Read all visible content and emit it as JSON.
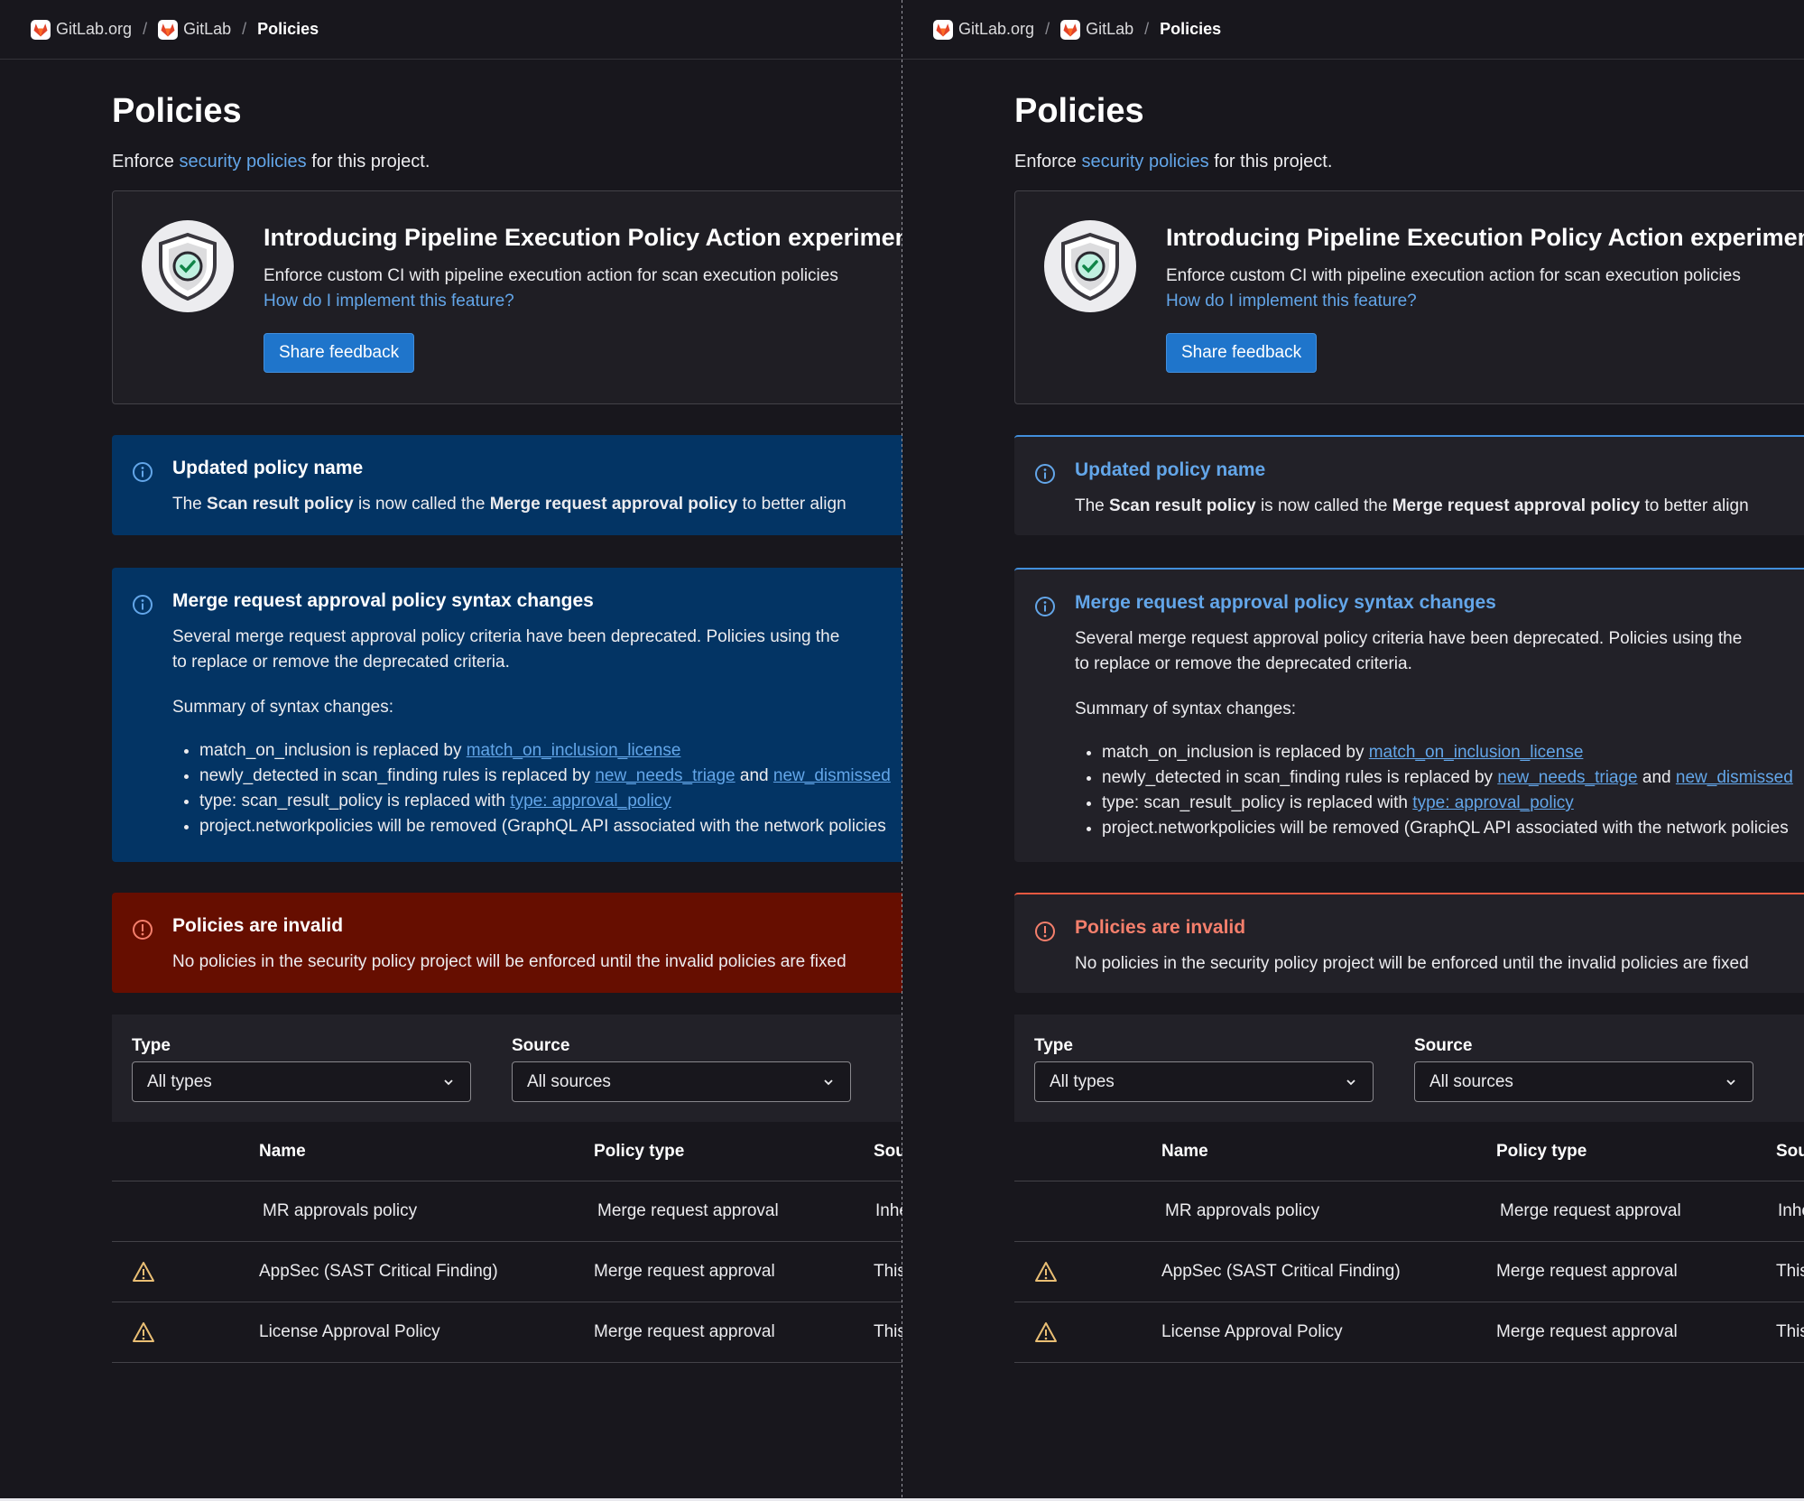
{
  "breadcrumb": {
    "items": [
      "GitLab.org",
      "GitLab"
    ],
    "separator": "/",
    "current": "Policies"
  },
  "page": {
    "title": "Policies",
    "subtitle_prefix": "Enforce",
    "subtitle_link": "security policies",
    "subtitle_suffix": "for this project."
  },
  "promo": {
    "icon": "shield-check-icon",
    "title": "Introducing Pipeline Execution Policy Action experimen",
    "text": "Enforce custom CI with pipeline execution action for scan execution policies",
    "link": "How do I implement this feature?",
    "button": "Share feedback"
  },
  "alerts": {
    "renamed": {
      "icon": "information-icon",
      "title": "Updated policy name",
      "pre": "The",
      "b1": "Scan result policy",
      "mid": "is now called the",
      "b2": "Merge request approval policy",
      "post": "to better align"
    },
    "syntax": {
      "icon": "information-icon",
      "title": "Merge request approval policy syntax changes",
      "line1": "Several merge request approval policy criteria have been deprecated. Policies using the",
      "line2": "to replace or remove the deprecated criteria.",
      "summary": "Summary of syntax changes:",
      "item1_text": "match_on_inclusion is replaced by",
      "item1_link": "match_on_inclusion_license",
      "item2_text": "newly_detected in scan_finding rules is replaced by",
      "item2_link1": "new_needs_triage",
      "item2_and": "and",
      "item2_link2": "new_dismissed",
      "item3_text": "type: scan_result_policy is replaced with",
      "item3_link": "type: approval_policy",
      "item4_text": "project.networkpolicies will be removed (GraphQL API associated with the network policies"
    },
    "invalid": {
      "icon": "error-icon",
      "title": "Policies are invalid",
      "text": "No policies in the security policy project will be enforced until the invalid policies are fixed"
    }
  },
  "filters": {
    "type_label": "Type",
    "type_value": "All types",
    "source_label": "Source",
    "source_value": "All sources"
  },
  "table": {
    "headers": [
      "Name",
      "Policy type",
      "Source"
    ],
    "rows": [
      {
        "warning": false,
        "name": "MR approvals policy",
        "type": "Merge request approval",
        "source": "Inherited"
      },
      {
        "warning": true,
        "name": "AppSec (SAST Critical Finding)",
        "type": "Merge request approval",
        "source": "This project"
      },
      {
        "warning": true,
        "name": "License Approval Policy",
        "type": "Merge request approval",
        "source": "This project"
      }
    ]
  },
  "colors": {
    "background": "#18171d",
    "link": "#63a6e9",
    "info_bg": "#033464",
    "danger_bg": "#660e00",
    "warning": "#e9be74",
    "confirm_button": "#1f75cb"
  }
}
